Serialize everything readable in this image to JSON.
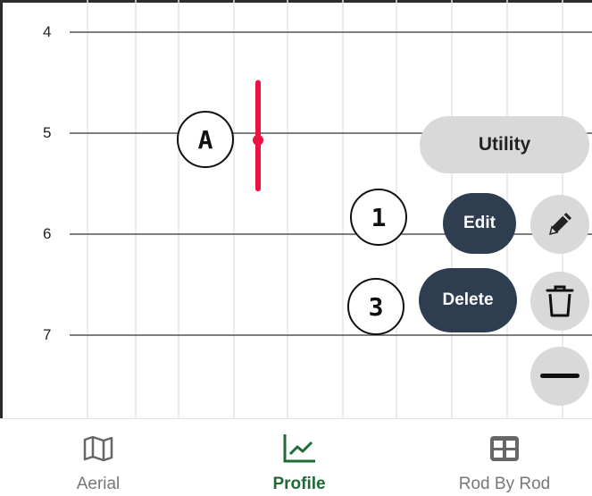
{
  "chart": {
    "y_ticks": [
      "4",
      "5",
      "6",
      "7"
    ],
    "marker": {
      "label": "A",
      "color": "#ee1144",
      "center_depth": 5.07,
      "min_depth": 4.5,
      "max_depth": 5.55
    }
  },
  "callouts": {
    "one": "1",
    "three": "3"
  },
  "menu": {
    "utility_label": "Utility",
    "edit_label": "Edit",
    "delete_label": "Delete",
    "accent": "#2e3e50",
    "icons": [
      "pencil-icon",
      "trash-icon",
      "minus-icon"
    ]
  },
  "nav": {
    "aerial_label": "Aerial",
    "profile_label": "Profile",
    "rod_label": "Rod By Rod",
    "active_color": "#1e6b35",
    "icons": [
      "map-icon",
      "line-chart-icon",
      "grid-icon"
    ]
  }
}
